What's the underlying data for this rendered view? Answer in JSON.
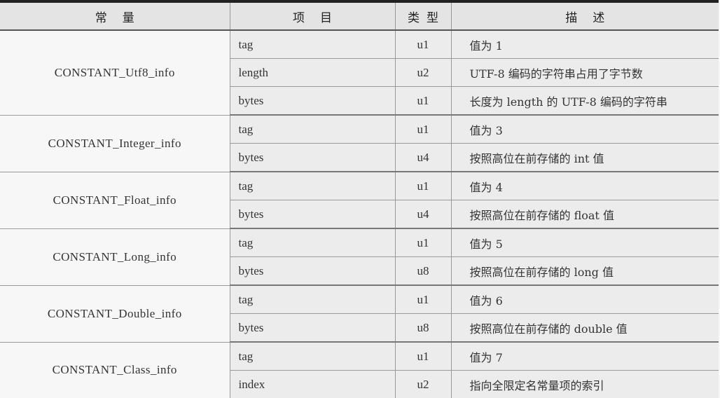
{
  "headers": {
    "constant": "常量",
    "item": "项目",
    "type": "类型",
    "description": "描述"
  },
  "groups": [
    {
      "name": "CONSTANT_Utf8_info",
      "rows": [
        {
          "item": "tag",
          "type": "u1",
          "desc": "值为 1"
        },
        {
          "item": "length",
          "type": "u2",
          "desc": "UTF-8 编码的字符串占用了字节数"
        },
        {
          "item": "bytes",
          "type": "u1",
          "desc": "长度为 length 的 UTF-8 编码的字符串"
        }
      ]
    },
    {
      "name": "CONSTANT_Integer_info",
      "rows": [
        {
          "item": "tag",
          "type": "u1",
          "desc": "值为 3"
        },
        {
          "item": "bytes",
          "type": "u4",
          "desc": "按照高位在前存储的 int 值"
        }
      ]
    },
    {
      "name": "CONSTANT_Float_info",
      "rows": [
        {
          "item": "tag",
          "type": "u1",
          "desc": "值为 4"
        },
        {
          "item": "bytes",
          "type": "u4",
          "desc": "按照高位在前存储的 float 值"
        }
      ]
    },
    {
      "name": "CONSTANT_Long_info",
      "rows": [
        {
          "item": "tag",
          "type": "u1",
          "desc": "值为 5"
        },
        {
          "item": "bytes",
          "type": "u8",
          "desc": "按照高位在前存储的 long 值"
        }
      ]
    },
    {
      "name": "CONSTANT_Double_info",
      "rows": [
        {
          "item": "tag",
          "type": "u1",
          "desc": "值为 6"
        },
        {
          "item": "bytes",
          "type": "u8",
          "desc": "按照高位在前存储的 double 值"
        }
      ]
    },
    {
      "name": "CONSTANT_Class_info",
      "rows": [
        {
          "item": "tag",
          "type": "u1",
          "desc": "值为 7"
        },
        {
          "item": "index",
          "type": "u2",
          "desc": "指向全限定名常量项的索引"
        }
      ]
    }
  ]
}
